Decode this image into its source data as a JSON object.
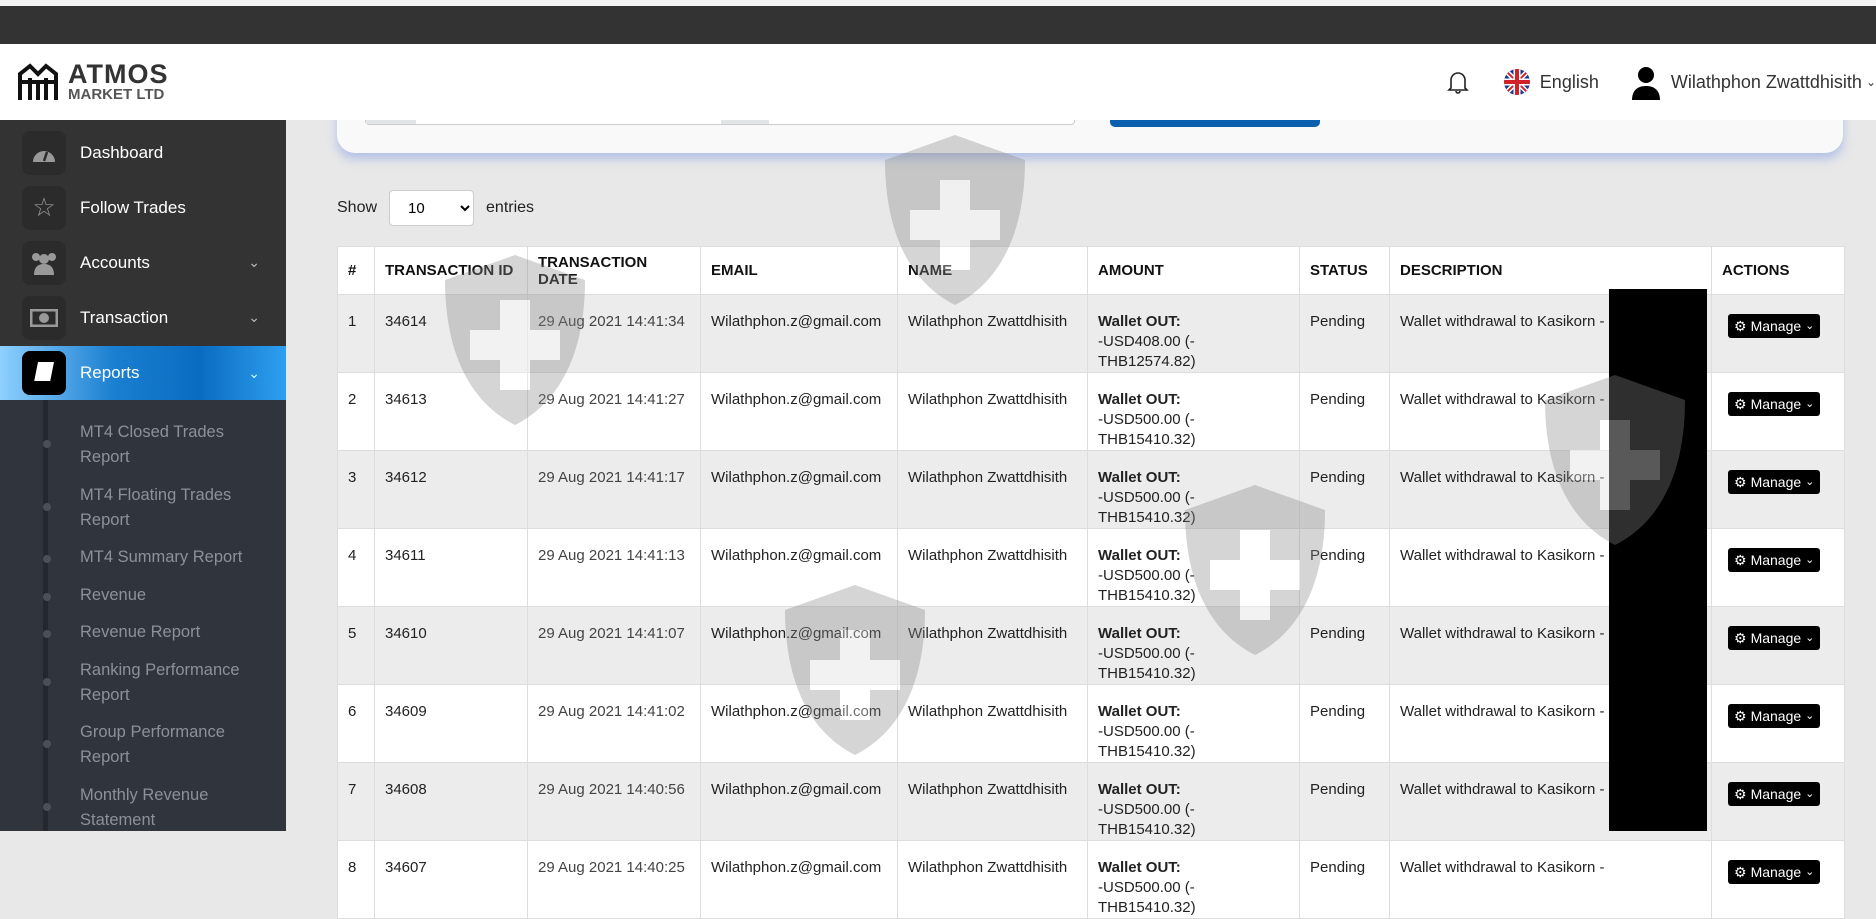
{
  "header": {
    "logo_line1": "ATMOS",
    "logo_line2": "MARKET LTD",
    "language": "English",
    "user_name": "Wilathphon Zwattdhisith"
  },
  "sidebar": {
    "items": [
      {
        "label": "Dashboard",
        "icon": "dashboard-icon"
      },
      {
        "label": "Follow Trades",
        "icon": "star-icon"
      },
      {
        "label": "Accounts",
        "icon": "users-icon",
        "expandable": true
      },
      {
        "label": "Transaction",
        "icon": "money-icon",
        "expandable": true
      },
      {
        "label": "Reports",
        "icon": "book-icon",
        "expandable": true,
        "active": true
      }
    ],
    "submenu": [
      "MT4 Closed Trades Report",
      "MT4 Floating Trades Report",
      "MT4 Summary Report",
      "Revenue",
      "Revenue Report",
      "Ranking Performance Report",
      "Group Performance Report",
      "Monthly Revenue Statement"
    ]
  },
  "entries": {
    "show_label": "Show",
    "value": "10",
    "suffix": "entries"
  },
  "table": {
    "headers": [
      "#",
      "TRANSACTION ID",
      "TRANSACTION DATE",
      "EMAIL",
      "NAME",
      "AMOUNT",
      "STATUS",
      "DESCRIPTION",
      "ACTIONS"
    ],
    "amount_label": "Wallet OUT:",
    "action_label": "Manage",
    "rows": [
      {
        "n": "1",
        "id": "34614",
        "date": "29 Aug 2021 14:41:34",
        "email": "Wilathphon.z@gmail.com",
        "name": "Wilathphon Zwattdhisith",
        "amount": "-USD408.00 (-THB12574.82)",
        "status": "Pending",
        "description": "Wallet withdrawal to Kasikorn -"
      },
      {
        "n": "2",
        "id": "34613",
        "date": "29 Aug 2021 14:41:27",
        "email": "Wilathphon.z@gmail.com",
        "name": "Wilathphon Zwattdhisith",
        "amount": "-USD500.00 (-THB15410.32)",
        "status": "Pending",
        "description": "Wallet withdrawal to Kasikorn -"
      },
      {
        "n": "3",
        "id": "34612",
        "date": "29 Aug 2021 14:41:17",
        "email": "Wilathphon.z@gmail.com",
        "name": "Wilathphon Zwattdhisith",
        "amount": "-USD500.00 (-THB15410.32)",
        "status": "Pending",
        "description": "Wallet withdrawal to Kasikorn -"
      },
      {
        "n": "4",
        "id": "34611",
        "date": "29 Aug 2021 14:41:13",
        "email": "Wilathphon.z@gmail.com",
        "name": "Wilathphon Zwattdhisith",
        "amount": "-USD500.00 (-THB15410.32)",
        "status": "Pending",
        "description": "Wallet withdrawal to Kasikorn -"
      },
      {
        "n": "5",
        "id": "34610",
        "date": "29 Aug 2021 14:41:07",
        "email": "Wilathphon.z@gmail.com",
        "name": "Wilathphon Zwattdhisith",
        "amount": "-USD500.00 (-THB15410.32)",
        "status": "Pending",
        "description": "Wallet withdrawal to Kasikorn -"
      },
      {
        "n": "6",
        "id": "34609",
        "date": "29 Aug 2021 14:41:02",
        "email": "Wilathphon.z@gmail.com",
        "name": "Wilathphon Zwattdhisith",
        "amount": "-USD500.00 (-THB15410.32)",
        "status": "Pending",
        "description": "Wallet withdrawal to Kasikorn -"
      },
      {
        "n": "7",
        "id": "34608",
        "date": "29 Aug 2021 14:40:56",
        "email": "Wilathphon.z@gmail.com",
        "name": "Wilathphon Zwattdhisith",
        "amount": "-USD500.00 (-THB15410.32)",
        "status": "Pending",
        "description": "Wallet withdrawal to Kasikorn -"
      },
      {
        "n": "8",
        "id": "34607",
        "date": "29 Aug 2021 14:40:25",
        "email": "Wilathphon.z@gmail.com",
        "name": "Wilathphon Zwattdhisith",
        "amount": "-USD500.00 (-THB15410.32)",
        "status": "Pending",
        "description": "Wallet withdrawal to Kasikorn -"
      }
    ]
  }
}
